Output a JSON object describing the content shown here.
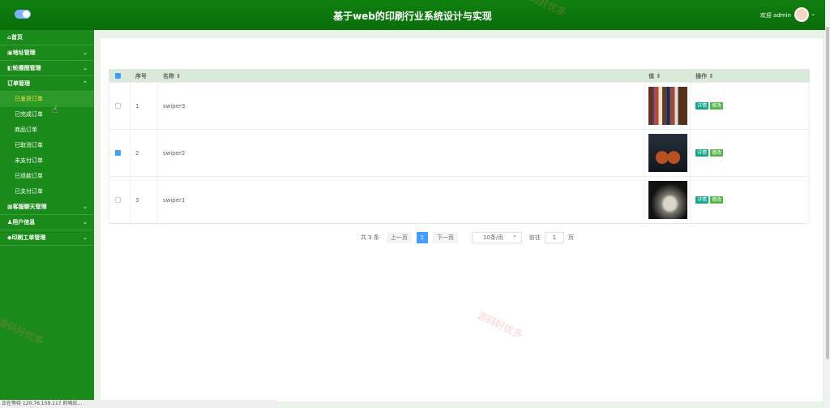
{
  "header": {
    "title": "基于web的印刷行业系统设计与实现",
    "welcome": "欢迎 admin"
  },
  "sidebar": {
    "items": [
      {
        "label": "首页"
      },
      {
        "label": "地址管理"
      },
      {
        "label": "轮播图管理"
      },
      {
        "label": "订单管理"
      },
      {
        "label": "已发货订单"
      },
      {
        "label": "已完成订单"
      },
      {
        "label": "商品订单"
      },
      {
        "label": "已取消订单"
      },
      {
        "label": "未支付订单"
      },
      {
        "label": "已退款订单"
      },
      {
        "label": "已支付订单"
      },
      {
        "label": "客服聊天管理"
      },
      {
        "label": "用户信息"
      },
      {
        "label": "印刷工单管理"
      }
    ]
  },
  "table": {
    "headers": [
      "序号",
      "名称 ⇕",
      "值 ⇕",
      "操作 ⇕"
    ],
    "rows": [
      {
        "index": "1",
        "name": "swiper3",
        "checked": false
      },
      {
        "index": "2",
        "name": "swiper2",
        "checked": true
      },
      {
        "index": "3",
        "name": "swiper1",
        "checked": false
      }
    ],
    "actions": {
      "detail": "详情",
      "edit": "修改"
    }
  },
  "pagination": {
    "total": "共 3 条",
    "prev": "上一页",
    "current": "1",
    "next": "下一页",
    "page_size": "10条/页",
    "goto": "前往",
    "page_value": "1",
    "page_suffix": "页"
  },
  "watermarks": [
    "源码好优多",
    "源码好优多",
    "源码好优多"
  ],
  "status_bar": "正在等待 120.76.159.117 的响应...",
  "icons": [
    "menu-toggle-icon",
    "home-icon",
    "address-icon",
    "carousel-icon",
    "orders-icon",
    "chat-icon",
    "user-icon",
    "print-icon",
    "chevron-down-icon",
    "chevron-up-icon",
    "checkbox-icon",
    "avatar-icon",
    "cursor-icon"
  ],
  "colors": {
    "header": "#0f7f0f",
    "sidebar": "#1a8a1a",
    "active_submenu": "#ffe43b",
    "accent": "#409eff"
  }
}
